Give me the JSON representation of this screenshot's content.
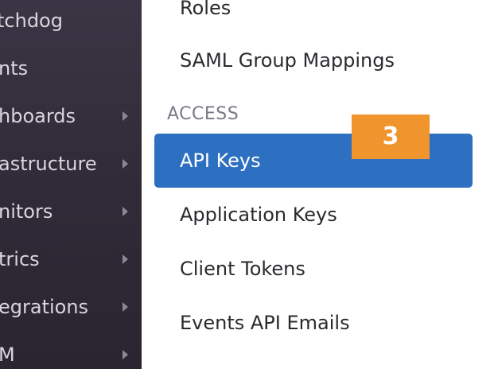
{
  "left_nav": {
    "items": [
      {
        "label": "tchdog",
        "has_submenu": false
      },
      {
        "label": "nts",
        "has_submenu": false
      },
      {
        "label": "hboards",
        "has_submenu": true
      },
      {
        "label": "astructure",
        "has_submenu": true
      },
      {
        "label": "nitors",
        "has_submenu": true
      },
      {
        "label": "trics",
        "has_submenu": true
      },
      {
        "label": "egrations",
        "has_submenu": true
      },
      {
        "label": "M",
        "has_submenu": true
      }
    ]
  },
  "settings_menu": {
    "items_above": [
      {
        "label": "Roles"
      },
      {
        "label": "SAML Group Mappings"
      }
    ],
    "section_heading": "ACCESS",
    "active_item": {
      "label": "API Keys"
    },
    "items_below": [
      {
        "label": "Application Keys"
      },
      {
        "label": "Client Tokens"
      },
      {
        "label": "Events API Emails"
      }
    ]
  },
  "step_badge": {
    "text": "3",
    "color": "#f0952d"
  },
  "colors": {
    "nav_bg": "#2f2a37",
    "active_bg": "#2d6fc0",
    "section_heading": "#7b7885"
  }
}
